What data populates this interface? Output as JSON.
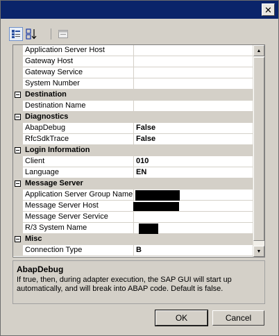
{
  "title_bar": {
    "close_glyph": "✕"
  },
  "toolbar": {
    "categorized_icon": "categorized-icon",
    "alphabetical_icon": "alphabetical-icon",
    "property_pages_icon": "property-pages-icon"
  },
  "grid": {
    "rows": [
      {
        "type": "prop",
        "name": "Application Server Host",
        "value": ""
      },
      {
        "type": "prop",
        "name": "Gateway Host",
        "value": ""
      },
      {
        "type": "prop",
        "name": "Gateway Service",
        "value": ""
      },
      {
        "type": "prop",
        "name": "System Number",
        "value": ""
      },
      {
        "type": "cat",
        "name": "Destination"
      },
      {
        "type": "prop",
        "name": "Destination Name",
        "value": ""
      },
      {
        "type": "cat",
        "name": "Diagnostics"
      },
      {
        "type": "prop",
        "name": "AbapDebug",
        "value": "False"
      },
      {
        "type": "prop",
        "name": "RfcSdkTrace",
        "value": "False"
      },
      {
        "type": "cat",
        "name": "Login Information"
      },
      {
        "type": "prop",
        "name": "Client",
        "value": "010"
      },
      {
        "type": "prop",
        "name": "Language",
        "value": "EN"
      },
      {
        "type": "cat",
        "name": "Message Server"
      },
      {
        "type": "prop",
        "name": "Application Server Group Name",
        "value": "",
        "redacted": true
      },
      {
        "type": "prop",
        "name": "Message Server Host",
        "value": "",
        "redacted": true
      },
      {
        "type": "prop",
        "name": "Message Server Service",
        "value": ""
      },
      {
        "type": "prop",
        "name": "R/3 System Name",
        "value": "",
        "redacted": true
      },
      {
        "type": "cat",
        "name": "Misc"
      },
      {
        "type": "prop",
        "name": "Connection Type",
        "value": "B"
      }
    ]
  },
  "description": {
    "title": "AbapDebug",
    "text": "If true, then, during adapter execution, the SAP GUI will start up automatically, and will break into ABAP code. Default is false."
  },
  "buttons": {
    "ok": "OK",
    "cancel": "Cancel"
  }
}
